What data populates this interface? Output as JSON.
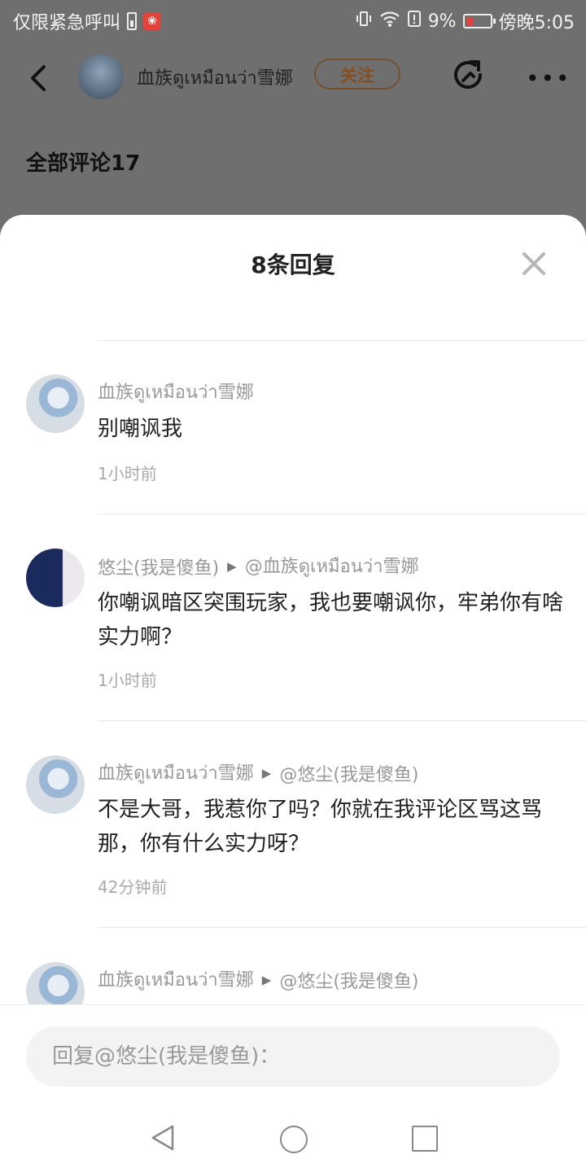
{
  "status_bar": {
    "left_text": "仅限紧急呼叫",
    "battery_percent": "9%",
    "time": "傍晚5:05",
    "icons": [
      "battery-small-icon",
      "app-notification-icon",
      "vibrate-icon",
      "wifi-icon",
      "sim-alert-icon",
      "battery-icon"
    ]
  },
  "page_header": {
    "user_name": "血族ดูเหมือนว่า雪娜",
    "follow_label": "关注",
    "all_comments": "全部评论17"
  },
  "sheet": {
    "title": "8条回复",
    "comments": [
      {
        "author": "血族ดูเหมือนว่า雪娜",
        "reply_to": "",
        "text": "别嘲讽我",
        "time": "1小时前"
      },
      {
        "author": "悠尘(我是傻鱼)",
        "reply_to": "@血族ดูเหมือนว่า雪娜",
        "text": "你嘲讽暗区突围玩家，我也要嘲讽你，牢弟你有啥实力啊？",
        "time": "1小时前"
      },
      {
        "author": "血族ดูเหมือนว่า雪娜",
        "reply_to": "@悠尘(我是傻鱼)",
        "text": "不是大哥，我惹你了吗？你就在我评论区骂这骂那，你有什么实力呀？",
        "time": "42分钟前"
      },
      {
        "author": "血族ดูเหมือนว่า雪娜",
        "reply_to": "@悠尘(我是傻鱼)",
        "text": "",
        "time": ""
      }
    ],
    "reply_placeholder": "回复@悠尘(我是傻鱼)："
  },
  "colors": {
    "overlay": "#6f6f6f",
    "follow_accent": "#8a4e1e",
    "meta_text": "#999999"
  }
}
